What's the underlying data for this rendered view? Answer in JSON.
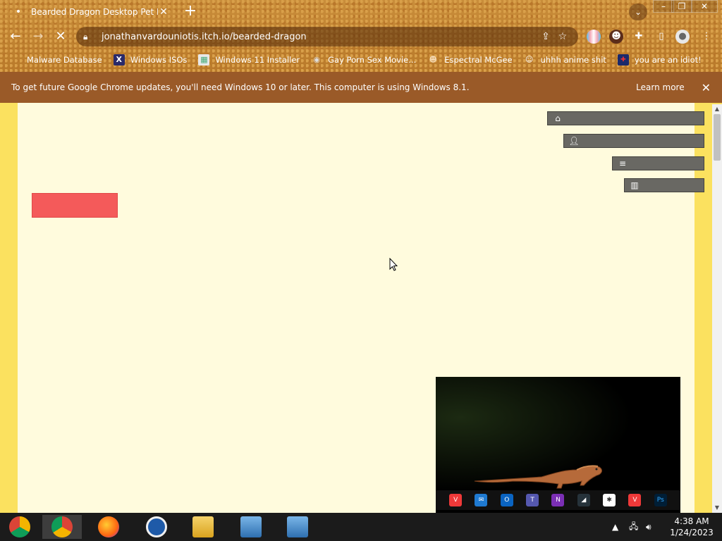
{
  "browser": {
    "tab": {
      "title": "Bearded Dragon Desktop Pet Lizard",
      "favicon": "loading-dot-icon"
    },
    "url": "jonathanvardouniotis.itch.io/bearded-dragon",
    "bookmarks": [
      {
        "label": "Malware Database",
        "icon": "folder-icon"
      },
      {
        "label": "Windows ISOs",
        "icon": "x-icon"
      },
      {
        "label": "Windows 11 Installer",
        "icon": "image-icon"
      },
      {
        "label": "Gay Porn Sex Movie...",
        "icon": "cd-icon"
      },
      {
        "label": "Espectral McGee",
        "icon": "character-icon"
      },
      {
        "label": "uhhh anime shit",
        "icon": "anime-icon"
      },
      {
        "label": "you are an idiot!",
        "icon": "flag-icon"
      }
    ]
  },
  "infobar": {
    "message": "To get future Google Chrome updates, you'll need Windows 10 or later. This computer is using Windows 8.1.",
    "link": "Learn more"
  },
  "page": {
    "side_buttons": [
      {
        "icon": "store-icon"
      },
      {
        "icon": "user-plus-icon"
      },
      {
        "icon": "add-to-list-icon"
      },
      {
        "icon": "map-icon"
      }
    ]
  },
  "taskbar": {
    "apps": [
      "chrome-canary",
      "chrome",
      "firefox",
      "internet-explorer",
      "file-explorer",
      "setup-1",
      "setup-2"
    ],
    "mini_apps": [
      "vivaldi",
      "mail",
      "outlook",
      "teams",
      "onenote",
      "app",
      "slack",
      "vivaldi",
      "photoshop"
    ],
    "mini_app_ps_label": "Ps",
    "time": "4:38 AM",
    "date": "1/24/2023"
  },
  "colors": {
    "page_bg": "#fffbdd",
    "page_border": "#fbe15f",
    "button_gray": "#696863",
    "red_button": "#f45a5a",
    "infobar": "#9a5a28"
  }
}
